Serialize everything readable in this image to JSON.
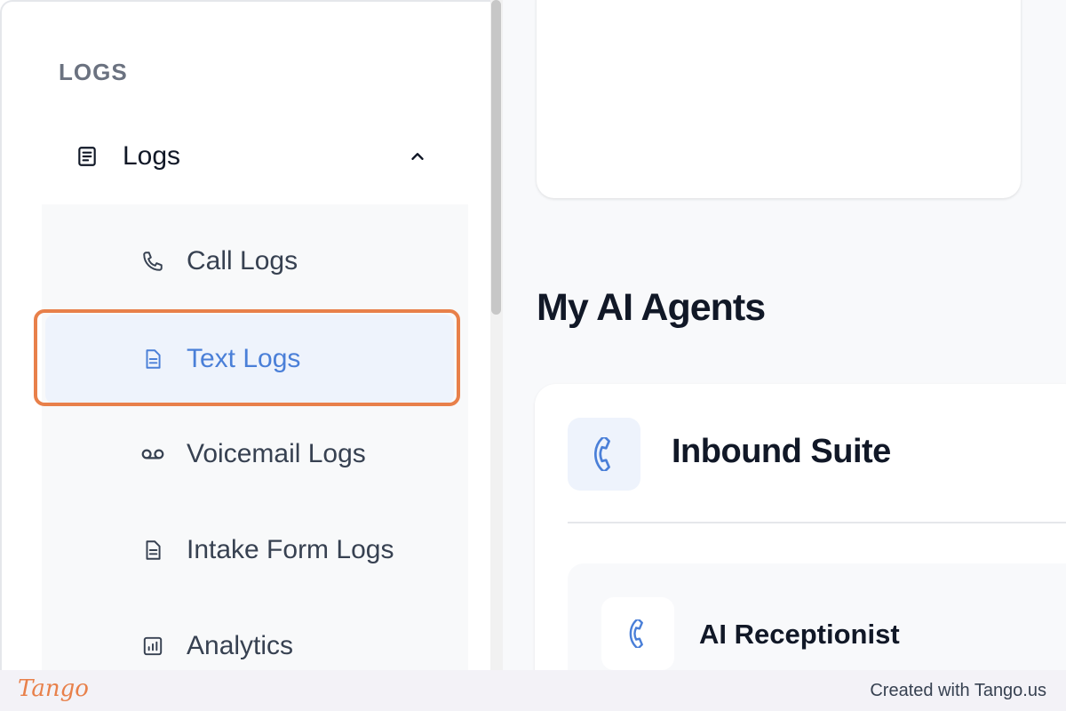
{
  "sidebar": {
    "section_title": "LOGS",
    "group": {
      "label": "Logs",
      "icon": "document-icon",
      "expanded": true
    },
    "items": [
      {
        "label": "Call Logs",
        "icon": "phone-icon",
        "active": false
      },
      {
        "label": "Text Logs",
        "icon": "document-icon",
        "active": true
      },
      {
        "label": "Voicemail Logs",
        "icon": "voicemail-icon",
        "active": false
      },
      {
        "label": "Intake Form Logs",
        "icon": "document-icon",
        "active": false
      },
      {
        "label": "Analytics",
        "icon": "analytics-icon",
        "active": false
      }
    ]
  },
  "main": {
    "heading": "My AI Agents",
    "suite": {
      "title": "Inbound Suite",
      "icon": "phone-icon",
      "agents": [
        {
          "name": "AI Receptionist",
          "icon": "phone-icon"
        }
      ]
    }
  },
  "footer": {
    "brand": "Tango",
    "credit": "Created with Tango.us"
  },
  "colors": {
    "accent": "#4a7fd8",
    "highlight": "#e8804a",
    "active_bg": "#eef3fc"
  }
}
